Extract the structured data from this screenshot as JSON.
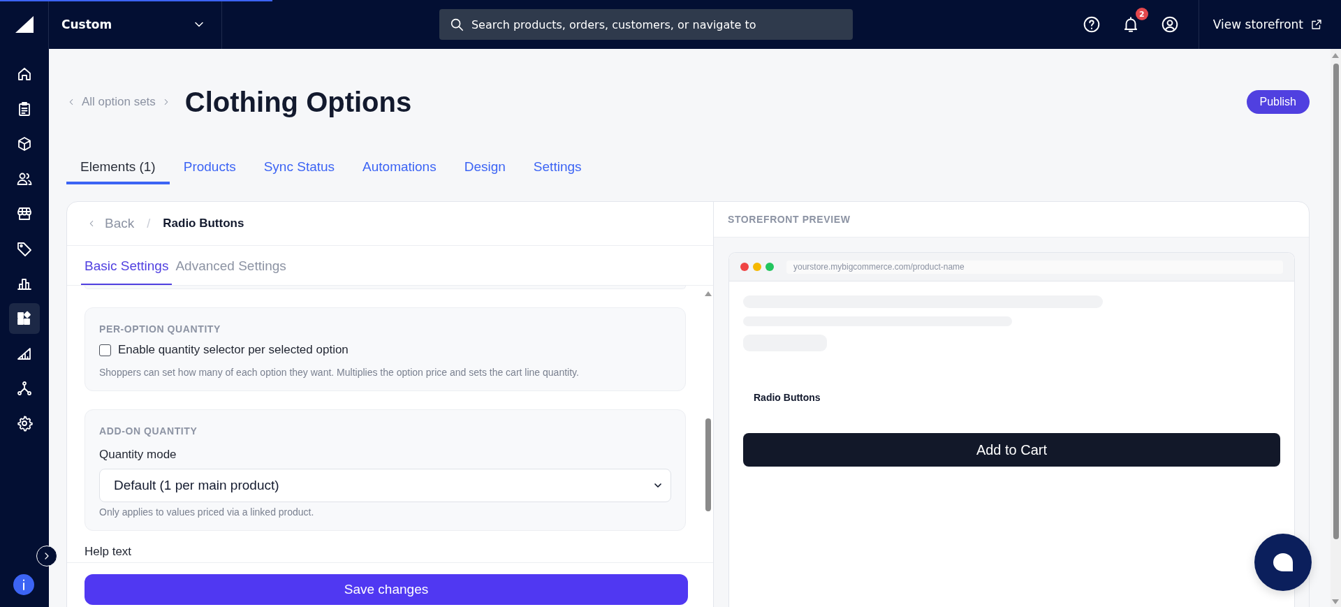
{
  "top_bar": {
    "store_selector": "Custom",
    "search": {
      "placeholder": "Search products, orders, customers, or navigate to"
    },
    "notification_count": "2",
    "view_storefront": "View storefront"
  },
  "sidebar": {
    "items": [
      {
        "kind": "home",
        "selected": false
      },
      {
        "kind": "clipboard",
        "selected": false
      },
      {
        "kind": "box",
        "selected": false
      },
      {
        "kind": "people",
        "selected": false
      },
      {
        "kind": "store",
        "selected": false
      },
      {
        "kind": "tag",
        "selected": false
      },
      {
        "kind": "chart",
        "selected": false
      },
      {
        "kind": "apps",
        "selected": true
      },
      {
        "kind": "angle",
        "selected": false
      },
      {
        "kind": "network",
        "selected": false
      },
      {
        "kind": "gear",
        "selected": false
      }
    ]
  },
  "breadcrumb": {
    "back_link": "All option sets"
  },
  "page_title": "Clothing Options",
  "publish_button": "Publish",
  "tabs": [
    {
      "label": "Elements (1)",
      "selected": true
    },
    {
      "label": "Products",
      "selected": false
    },
    {
      "label": "Sync Status",
      "selected": false
    },
    {
      "label": "Automations",
      "selected": false
    },
    {
      "label": "Design",
      "selected": false
    },
    {
      "label": "Settings",
      "selected": false
    }
  ],
  "editor": {
    "back": "Back",
    "separator": "/",
    "element_name": "Radio Buttons",
    "tabs": [
      {
        "label": "Basic Settings",
        "selected": true
      },
      {
        "label": "Advanced Settings",
        "selected": false
      }
    ],
    "sections": [
      {
        "kind": "checkbox",
        "heading": "PER-OPTION QUANTITY",
        "label": "Enable quantity selector per selected option",
        "checked": false,
        "hint": "Shoppers can set how many of each option they want. Multiplies the option price and sets the cart line quantity."
      },
      {
        "kind": "select",
        "heading": "ADD-ON QUANTITY",
        "label": "Quantity mode",
        "value": "Default (1 per main product)",
        "hint": "Only applies to values priced via a linked product."
      }
    ],
    "help_text_label": "Help text",
    "save_button": "Save changes"
  },
  "preview": {
    "heading": "STOREFRONT PREVIEW",
    "url": "yourstore.mybigcommerce.com/product-name",
    "option_label": "Radio Buttons",
    "add_to_cart": "Add to Cart"
  }
}
